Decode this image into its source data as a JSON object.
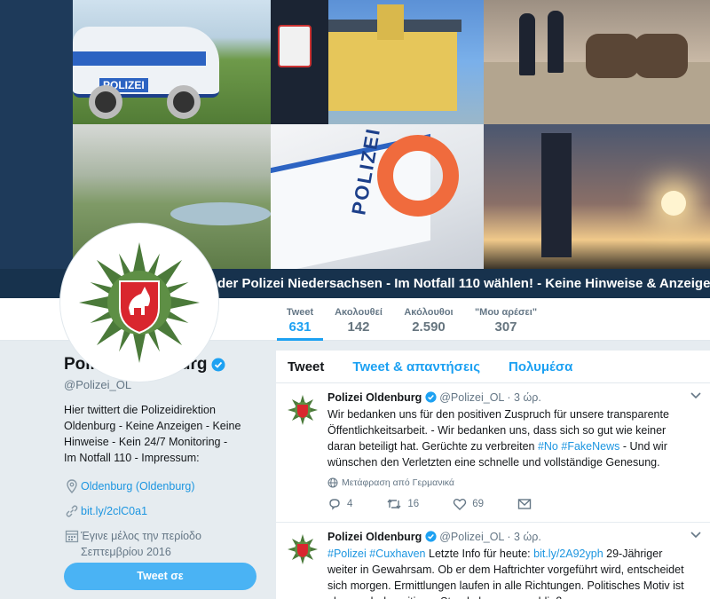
{
  "banner": {
    "ticker_text": "der Polizei Niedersachsen - Im Notfall 110 wählen! - Keine Hinweise & Anzeigen",
    "car_text": "POLIZEI",
    "ship_text": "POLIZEI"
  },
  "nav": {
    "stats": [
      {
        "label": "Tweet",
        "value": "631",
        "active": true
      },
      {
        "label": "Ακολουθεί",
        "value": "142"
      },
      {
        "label": "Ακόλουθοι",
        "value": "2.590"
      },
      {
        "label": "\"Μου αρέσει\"",
        "value": "307"
      }
    ]
  },
  "profile": {
    "name": "Polizei Oldenburg",
    "handle": "@Polizei_OL",
    "bio": "Hier twittert die Polizeidirektion Oldenburg - Keine Anzeigen - Keine Hinweise - Kein 24/7 Monitoring - Im Notfall 110 - Impressum:",
    "location": "Oldenburg (Oldenburg)",
    "url": "bit.ly/2clC0a1",
    "joined": "Έγινε μέλος την περίοδο Σεπτεμβρίου 2016",
    "tweet_to_label": "Tweet σε"
  },
  "timeline": {
    "tabs": [
      "Tweet",
      "Tweet & απαντήσεις",
      "Πολυμέσα"
    ],
    "tweets": [
      {
        "name": "Polizei Oldenburg",
        "handle": "@Polizei_OL",
        "time": "· 3 ώρ.",
        "text_a": "Wir bedanken uns für den positiven Zuspruch für unsere transparente Öffentlichkeitsarbeit. - Wir bedanken uns, dass sich so gut wie keiner daran beteiligt hat. Gerüchte zu verbreiten ",
        "tag1": "#No",
        "tag2": "#FakeNews",
        "text_b": " - Und wir wünschen den Verletzten eine schnelle und vollständige Genesung.",
        "translate": "Μετάφραση από Γερμανικά",
        "replies": "4",
        "retweets": "16",
        "likes": "69"
      },
      {
        "name": "Polizei Oldenburg",
        "handle": "@Polizei_OL",
        "time": "· 3 ώρ.",
        "tag1": "#Polizei",
        "tag2": "#Cuxhaven",
        "text_a": " Letzte Info für heute: ",
        "link": "bit.ly/2A92yph",
        "text_b": " 29-Jähriger weiter in Gewahrsam. Ob er dem Haftrichter vorgeführt wird, entscheidet sich morgen. Ermittlungen laufen in alle Richtungen. Politisches Motiv ist aber nach derzeitigem Stand eher auszuschließen."
      }
    ]
  },
  "colors": {
    "accent": "#1da1f2",
    "link": "#1b95e0",
    "button": "#4ab3f4",
    "banner": "#17324d"
  }
}
